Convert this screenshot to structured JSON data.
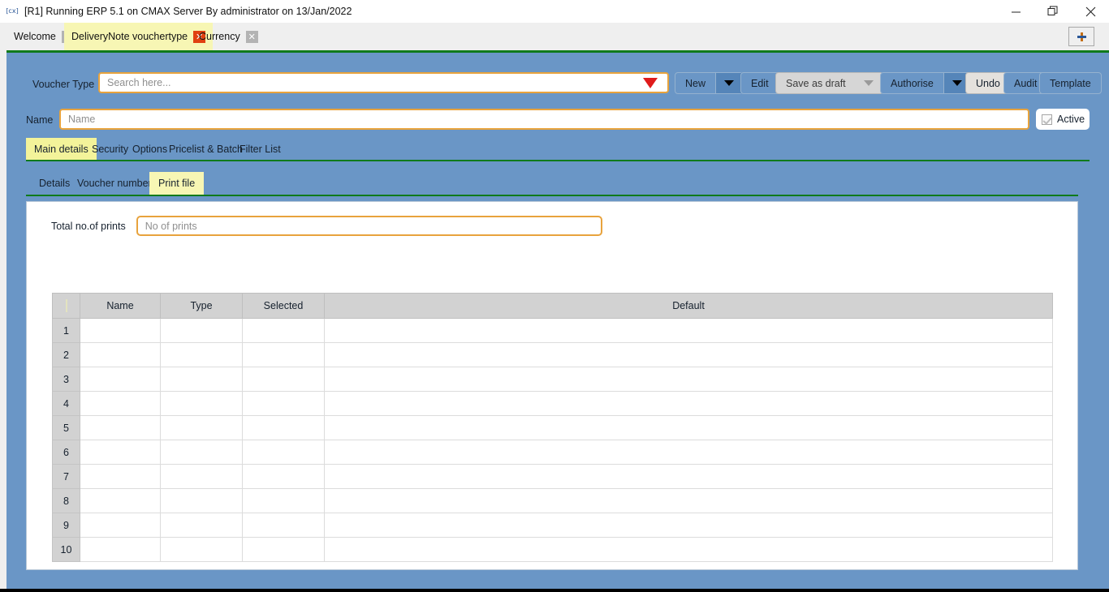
{
  "window": {
    "title": "[R1] Running ERP 5.1 on CMAX Server By administrator on 13/Jan/2022",
    "app_icon": "erp-app-icon",
    "minimize_icon": "minimize-icon",
    "maximize_icon": "maximize-icon",
    "close_icon": "close-icon"
  },
  "tabs": {
    "items": [
      {
        "label": "Welcome",
        "close": "✕",
        "active": false
      },
      {
        "label": "DeliveryNote vouchertype",
        "close": "✕",
        "active": true
      },
      {
        "label": "Currency",
        "close": "✕",
        "active": false
      }
    ],
    "new_tab_label": "+"
  },
  "toolbar": {
    "voucher_type_label": "Voucher Type",
    "search_placeholder": "Search here...",
    "new_label": "New",
    "edit_label": "Edit",
    "save_as_draft_label": "Save as draft",
    "authorise_label": "Authorise",
    "undo_label": "Undo",
    "audit_label": "Audit",
    "template_label": "Template"
  },
  "form": {
    "name_label": "Name",
    "name_placeholder": "Name",
    "name_value": "",
    "active_label": "Active"
  },
  "main_tabs": [
    {
      "label": "Main details",
      "active": true
    },
    {
      "label": "Security",
      "active": false
    },
    {
      "label": "Options",
      "active": false
    },
    {
      "label": "Pricelist & Batch",
      "active": false
    },
    {
      "label": "Filter List",
      "active": false
    }
  ],
  "sub_tabs": [
    {
      "label": "Details",
      "active": false
    },
    {
      "label": "Voucher numbering",
      "active": false
    },
    {
      "label": "Print file",
      "active": true
    }
  ],
  "print_file": {
    "total_prints_label": "Total no.of prints",
    "total_prints_placeholder": "No of prints",
    "total_prints_value": "",
    "table": {
      "columns": [
        "",
        "Name",
        "Type",
        "Selected",
        "Default"
      ],
      "rows": [
        {
          "num": "1",
          "name": "",
          "type": "",
          "selected": "",
          "default": ""
        },
        {
          "num": "2",
          "name": "",
          "type": "",
          "selected": "",
          "default": ""
        },
        {
          "num": "3",
          "name": "",
          "type": "",
          "selected": "",
          "default": ""
        },
        {
          "num": "4",
          "name": "",
          "type": "",
          "selected": "",
          "default": ""
        },
        {
          "num": "5",
          "name": "",
          "type": "",
          "selected": "",
          "default": ""
        },
        {
          "num": "6",
          "name": "",
          "type": "",
          "selected": "",
          "default": ""
        },
        {
          "num": "7",
          "name": "",
          "type": "",
          "selected": "",
          "default": ""
        },
        {
          "num": "8",
          "name": "",
          "type": "",
          "selected": "",
          "default": ""
        },
        {
          "num": "9",
          "name": "",
          "type": "",
          "selected": "",
          "default": ""
        },
        {
          "num": "10",
          "name": "",
          "type": "",
          "selected": "",
          "default": ""
        }
      ]
    }
  },
  "colors": {
    "app_background": "#6a96c6",
    "accent_green": "#0f7a1b",
    "tab_active_yellow": "#f7f6b4",
    "input_border_orange": "#e8a33d",
    "search_caret_red": "#e01b1b"
  }
}
